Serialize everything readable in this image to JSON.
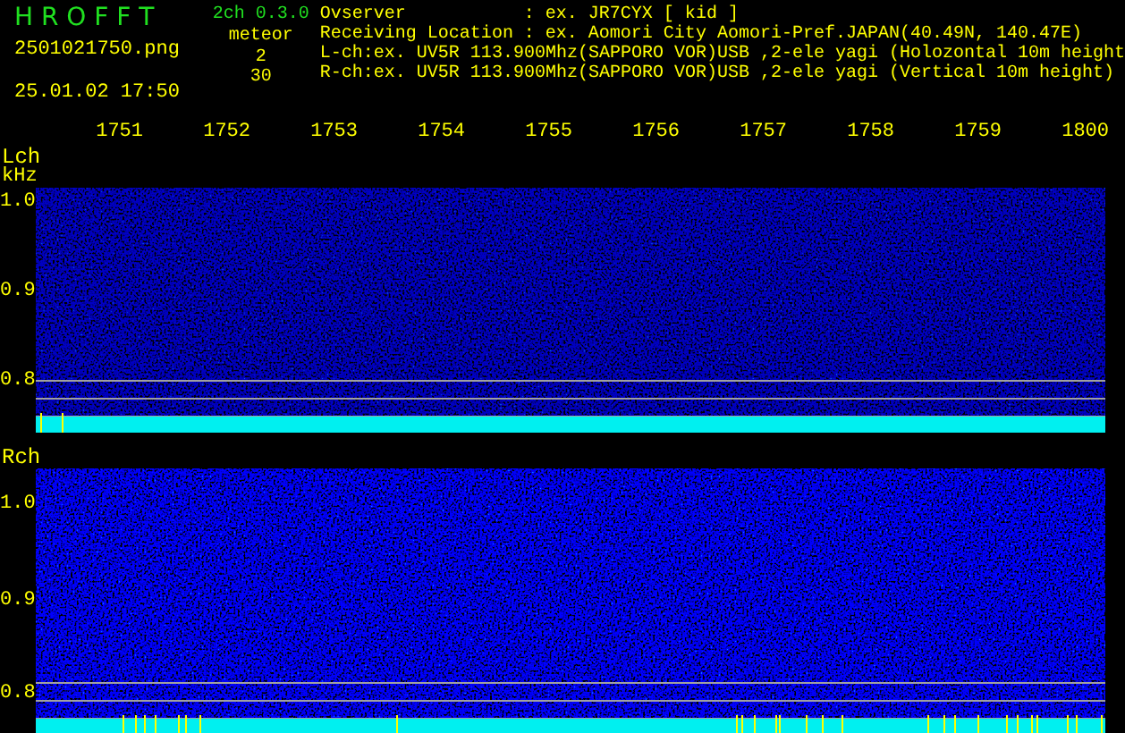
{
  "header": {
    "app_name": "H R O F F T",
    "version": "2ch 0.3.0",
    "filename": "2501021750.png",
    "datetime": "25.01.02 17:50",
    "meteor_label": "meteor",
    "meteor_counts": [
      "2",
      "30"
    ],
    "info": [
      {
        "label": "Ovserver",
        "value": ": ex. JR7CYX [ kid ]"
      },
      {
        "label": "Receiving Location",
        "value": ": ex. Aomori City Aomori-Pref.JAPAN(40.49N, 140.47E)"
      }
    ],
    "channels_info": [
      "L-ch:ex. UV5R 113.900Mhz(SAPPORO VOR)USB ,2-ele yagi (Holozontal 10m height",
      "R-ch:ex. UV5R 113.900Mhz(SAPPORO VOR)USB ,2-ele yagi (Vertical 10m height)"
    ]
  },
  "time_labels": [
    "1751",
    "1752",
    "1753",
    "1754",
    "1755",
    "1756",
    "1757",
    "1758",
    "1759",
    "1800"
  ],
  "panels": [
    {
      "name": "Lch",
      "unit": "kHz",
      "freq_labels": [
        "1.0",
        "0.9",
        "0.8"
      ]
    },
    {
      "name": "Rch",
      "freq_labels": [
        "1.0",
        "0.9",
        "0.8"
      ]
    }
  ]
}
